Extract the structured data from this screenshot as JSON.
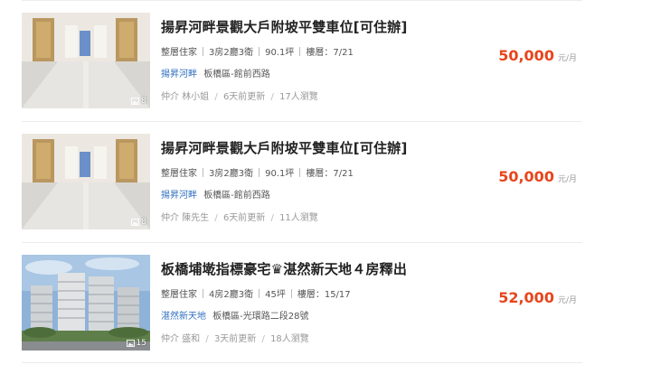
{
  "listings": [
    {
      "title": "揚昇河畔景觀大戶附坡平雙車位[可住辦]",
      "specs": [
        "整層住家",
        "3房2廳3衛",
        "90.1坪",
        "樓層：7/21"
      ],
      "community": "揚昇河畔",
      "address": "板橋區-館前西路",
      "meta": [
        "仲介 林小姐",
        "6天前更新",
        "17人瀏覽"
      ],
      "price": "50,000",
      "price_unit": "元/月",
      "photo_count": "8",
      "photo_type": "interior"
    },
    {
      "title": "揚昇河畔景觀大戶附坡平雙車位[可住辦]",
      "specs": [
        "整層住家",
        "3房2廳3衛",
        "90.1坪",
        "樓層：7/21"
      ],
      "community": "揚昇河畔",
      "address": "板橋區-館前西路",
      "meta": [
        "仲介 陳先生",
        "6天前更新",
        "11人瀏覽"
      ],
      "price": "50,000",
      "price_unit": "元/月",
      "photo_count": "8",
      "photo_type": "interior"
    },
    {
      "title": "板橋埔墘指標豪宅♛湛然新天地４房釋出",
      "specs": [
        "整層住家",
        "4房2廳3衛",
        "45坪",
        "樓層：15/17"
      ],
      "community": "湛然新天地",
      "address": "板橋區-光環路二段28號",
      "meta": [
        "仲介 盛和",
        "3天前更新",
        "18人瀏覽"
      ],
      "price": "52,000",
      "price_unit": "元/月",
      "photo_count": "15",
      "photo_type": "building"
    }
  ],
  "icons": {
    "photo_count": "image-icon"
  },
  "colors": {
    "price": "#e8451b",
    "community_link": "#2f6fc0"
  }
}
